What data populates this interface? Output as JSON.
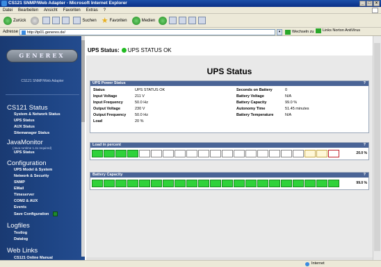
{
  "window": {
    "title": "CS121 SNMP/Web Adapter - Microsoft Internet Explorer",
    "min": "_",
    "max": "□",
    "close": "×"
  },
  "menu": [
    "Datei",
    "Bearbeiten",
    "Ansicht",
    "Favoriten",
    "Extras",
    "?"
  ],
  "toolbar": {
    "back": "Zurück",
    "search": "Suchen",
    "favorites": "Favoriten",
    "media": "Medien"
  },
  "address": {
    "label": "Adresse",
    "url": "http://tp01.generex.de/",
    "go": "Wechseln zu",
    "links": "Links  Norton AntiVirus"
  },
  "sidebar": {
    "logo": "GENEREX",
    "caption": "CS121 SNMP/Web Adapter",
    "sections": [
      {
        "title": "CS121 Status",
        "items": [
          "System & Network Status",
          "UPS Status",
          "AUX Status",
          "Sitemanager Status"
        ]
      },
      {
        "title": "JavaMonitor",
        "note": "(Java runtime 1.4x required)",
        "items": [
          "UPS Status"
        ]
      },
      {
        "title": "Configuration",
        "items": [
          "UPS Model & System",
          "Network & Security",
          "SNMP",
          "EMail",
          "Timeserver",
          "COM2 & AUX",
          "Events",
          "Save Configuration"
        ]
      },
      {
        "title": "Logfiles",
        "items": [
          "Testlog",
          "Datalog"
        ]
      },
      {
        "title": "Web Links",
        "items": [
          "CS121 Online Manual"
        ]
      }
    ]
  },
  "ups_status": {
    "label": "UPS Status:",
    "value": "UPS STATUS OK",
    "indicator_color": "#22bb22"
  },
  "page_title": "UPS Status",
  "power_panel": {
    "title": "UPS Power Status",
    "help": "?",
    "left": [
      {
        "label": "Status",
        "value": "UPS STATUS OK"
      },
      {
        "label": "Input Voltage",
        "value": "211 V"
      },
      {
        "label": "Input Frequency",
        "value": "50.0 Hz"
      },
      {
        "label": "Output Voltage",
        "value": "230 V"
      },
      {
        "label": "Output Frequency",
        "value": "50.0 Hz"
      },
      {
        "label": "Load",
        "value": "20 %"
      }
    ],
    "right": [
      {
        "label": "Seconds on Battery",
        "value": "0"
      },
      {
        "label": "Battery Voltage",
        "value": "N/A"
      },
      {
        "label": "Battery Capacity",
        "value": "99.0 %"
      },
      {
        "label": "Autonomy Time",
        "value": "51.45 minutes"
      },
      {
        "label": "Battery Temperature",
        "value": "N/A"
      }
    ]
  },
  "load_panel": {
    "title": "Load in percent",
    "help": "?",
    "percent_text": "20.0 %",
    "fraction": 0.2
  },
  "battery_panel": {
    "title": "Battery Capacity",
    "help": "?",
    "percent_text": "99.0 %",
    "fraction": 0.99
  },
  "statusbar": {
    "zone": "Internet"
  },
  "colors": {
    "sidebar": "#1e4585",
    "panel_header": "#4a6496",
    "bar_on": "#2fd23a"
  }
}
